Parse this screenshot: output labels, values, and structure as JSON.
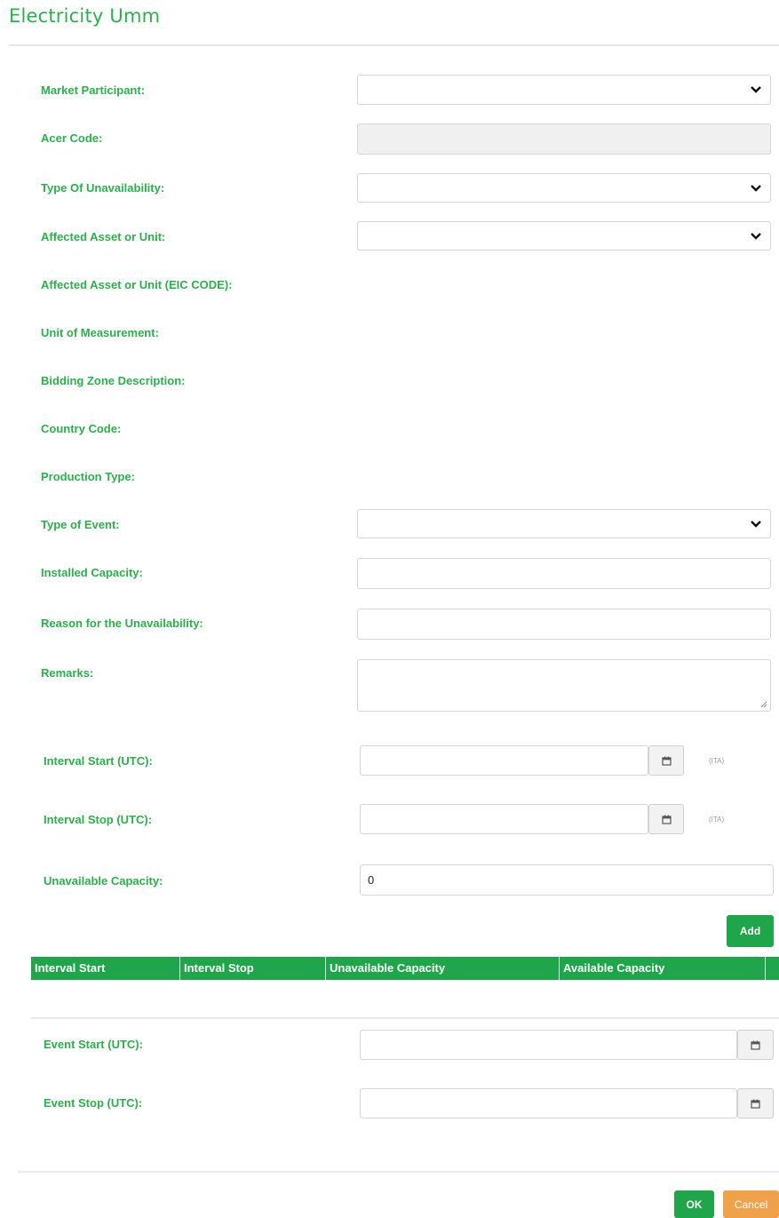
{
  "header": {
    "title": "Electricity Umm"
  },
  "form": {
    "market_participant": {
      "label": "Market Participant:",
      "value": ""
    },
    "acer_code": {
      "label": "Acer Code:",
      "value": ""
    },
    "type_of_unavailability": {
      "label": "Type Of Unavailability:",
      "value": ""
    },
    "affected_asset": {
      "label": "Affected Asset or Unit:",
      "value": ""
    },
    "affected_asset_eic": {
      "label": "Affected Asset or Unit (EIC CODE):"
    },
    "unit_of_measurement": {
      "label": "Unit of Measurement:"
    },
    "bidding_zone": {
      "label": "Bidding Zone Description:"
    },
    "country_code": {
      "label": "Country Code:"
    },
    "production_type": {
      "label": "Production Type:"
    },
    "type_of_event": {
      "label": "Type of Event:",
      "value": ""
    },
    "installed_capacity": {
      "label": "Installed Capacity:",
      "value": ""
    },
    "reason": {
      "label": "Reason for the Unavailability:",
      "value": ""
    },
    "remarks": {
      "label": "Remarks:",
      "value": ""
    }
  },
  "intervals": {
    "interval_start": {
      "label": "Interval Start (UTC):",
      "value": "",
      "tz": "(ITA)"
    },
    "interval_stop": {
      "label": "Interval Stop (UTC):",
      "value": "",
      "tz": "(ITA)"
    },
    "unavailable_capacity": {
      "label": "Unavailable Capacity:",
      "value": "0"
    },
    "add_label": "Add",
    "table": {
      "columns": [
        "Interval Start",
        "Interval Stop",
        "Unavailable Capacity",
        "Available Capacity"
      ],
      "rows": []
    }
  },
  "event": {
    "event_start": {
      "label": "Event Start (UTC):",
      "value": ""
    },
    "event_stop": {
      "label": "Event Stop (UTC):",
      "value": ""
    }
  },
  "footer": {
    "ok_label": "OK",
    "cancel_label": "Cancel"
  },
  "icons": {
    "dropdown": "chevron-down-icon",
    "date_picker": "calendar-icon",
    "resize": "resize-grip-icon"
  },
  "colors": {
    "accent": "#2bb04b",
    "button_green": "#1fa64a",
    "button_orange": "#f0a24a"
  }
}
